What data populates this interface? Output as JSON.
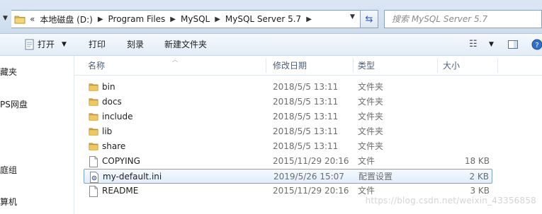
{
  "address": {
    "overflow": "«",
    "crumbs": [
      "本地磁盘 (D:)",
      "Program Files",
      "MySQL",
      "MySQL Server 5.7"
    ],
    "search_placeholder": "搜索 MySQL Server 5.7"
  },
  "toolbar": {
    "open": "打开",
    "print": "打印",
    "burn": "刻录",
    "new_folder": "新建文件夹"
  },
  "nav": [
    "藏夹",
    "PS网盘",
    "庭组",
    "算机"
  ],
  "columns": {
    "name": "名称",
    "date": "修改日期",
    "type": "类型",
    "size": "大小"
  },
  "files": [
    {
      "name": "bin",
      "date": "2018/5/5 13:11",
      "type": "文件夹",
      "size": "",
      "icon": "folder-icon"
    },
    {
      "name": "docs",
      "date": "2018/5/5 13:11",
      "type": "文件夹",
      "size": "",
      "icon": "folder-icon"
    },
    {
      "name": "include",
      "date": "2018/5/5 13:11",
      "type": "文件夹",
      "size": "",
      "icon": "folder-icon"
    },
    {
      "name": "lib",
      "date": "2018/5/5 13:11",
      "type": "文件夹",
      "size": "",
      "icon": "folder-icon"
    },
    {
      "name": "share",
      "date": "2018/5/5 13:11",
      "type": "文件夹",
      "size": "",
      "icon": "folder-icon"
    },
    {
      "name": "COPYING",
      "date": "2015/11/29 20:16",
      "type": "文件",
      "size": "18 KB",
      "icon": "file-icon"
    },
    {
      "name": "my-default.ini",
      "date": "2019/5/26 15:07",
      "type": "配置设置",
      "size": "2 KB",
      "icon": "settings-file-icon",
      "selected": true
    },
    {
      "name": "README",
      "date": "2015/11/29 20:16",
      "type": "文件",
      "size": "3 KB",
      "icon": "file-icon"
    }
  ],
  "watermark": "https://blog.csdn.net/weixin_43356858"
}
